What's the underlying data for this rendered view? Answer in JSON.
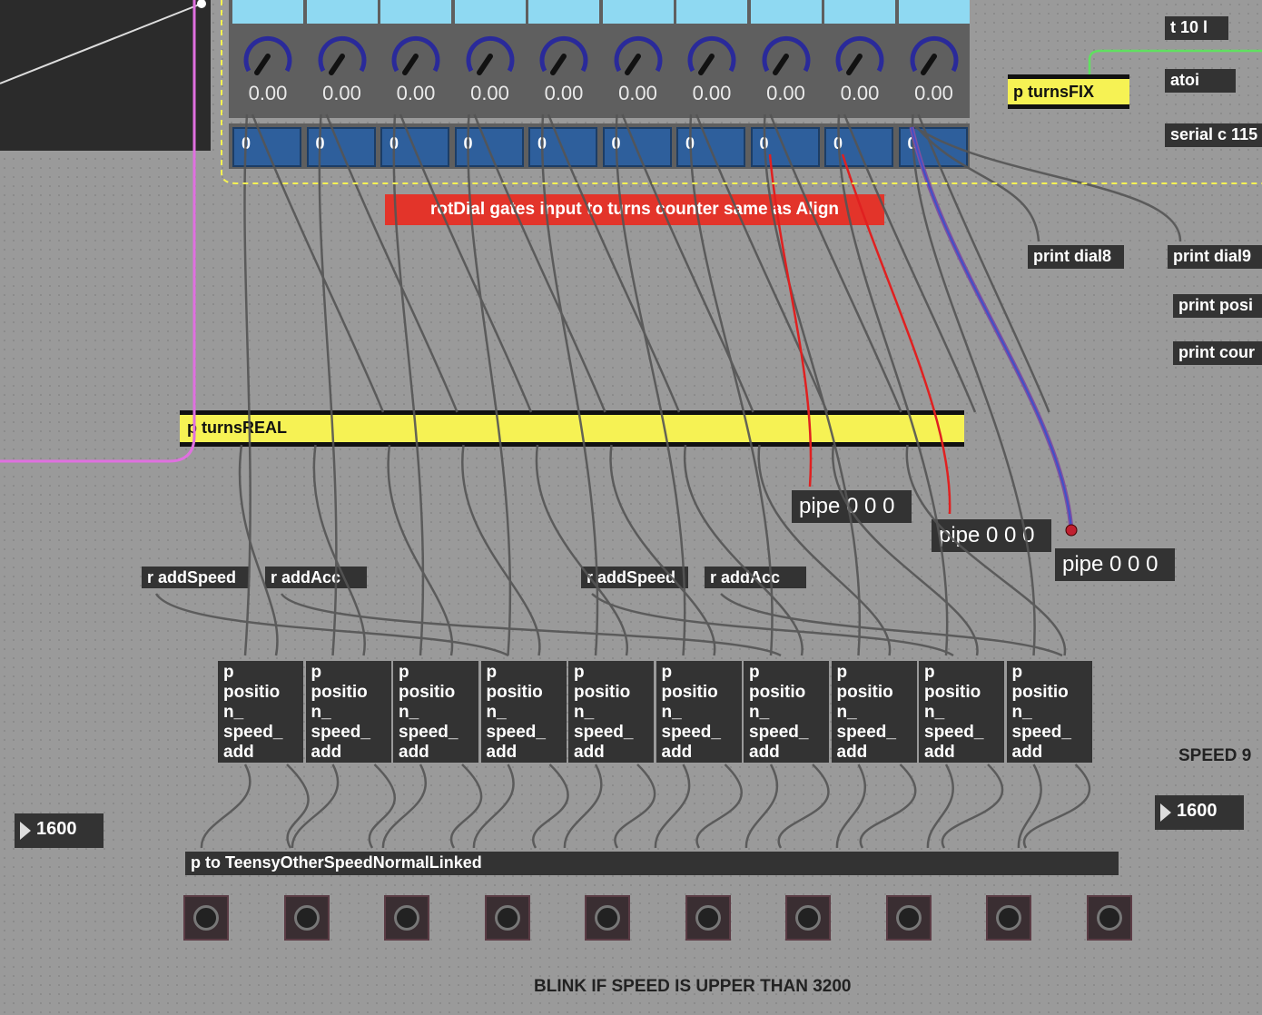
{
  "colors": {
    "canvas": "#9a9a9a",
    "object": "#333333",
    "subpatch_yellow": "#f6f254",
    "alert_red": "#e3342a",
    "dial_arc": "#2a2a9a",
    "toggle_blue": "#2e5f9c",
    "patchcord_magenta": "#e070e0",
    "patchcord_red": "#e02020",
    "patchcord_blue": "#4050c8",
    "patchcord_green": "#60e060"
  },
  "top_right": {
    "t_object": "t 10 l",
    "atoi": "atoi",
    "serial": "serial c 115"
  },
  "turns_fix": "p turnsFIX",
  "print_objects": [
    "print dial8",
    "print dial9",
    "print posi",
    "print cour"
  ],
  "alert_comment": "rotDial gates input to turns counter same as Align",
  "turns_real": "p turnsREAL",
  "dials": {
    "count": 10,
    "value": "0.00",
    "icon": "dial-knob-icon"
  },
  "toggles": [
    "0",
    "0",
    "0",
    "0",
    "0",
    "0",
    "0",
    "0",
    "0",
    "0"
  ],
  "pipes": [
    "pipe 0 0 0",
    "pipe 0 0 0",
    "pipe 0 0 0"
  ],
  "receive_objects": [
    "r addSpeed",
    "r addAcc",
    "r addSpeed",
    "r addAcc"
  ],
  "position_objects": [
    "p\npositio\nn_\nspeed_\nadd",
    "p\npositio\nn_\nspeed_\nadd",
    "p\npositio\nn_\nspeed_\nadd",
    "p\npositio\nn_\nspeed_\nadd",
    "p\npositio\nn_\nspeed_\nadd",
    "p\npositio\nn_\nspeed_\nadd",
    "p\npositio\nn_\nspeed_\nadd",
    "p\npositio\nn_\nspeed_\nadd",
    "p\npositio\nn_\nspeed_\nadd",
    "p\npositio\nn_\nspeed_\nadd"
  ],
  "speed_label": "SPEED 9",
  "number_boxes": [
    "1600",
    "1600"
  ],
  "teensy": "p to TeensyOtherSpeedNormalLinked",
  "leds": {
    "count": 10,
    "icon": "led-indicator-icon"
  },
  "blink_comment": "BLINK IF SPEED IS UPPER THAN 3200"
}
